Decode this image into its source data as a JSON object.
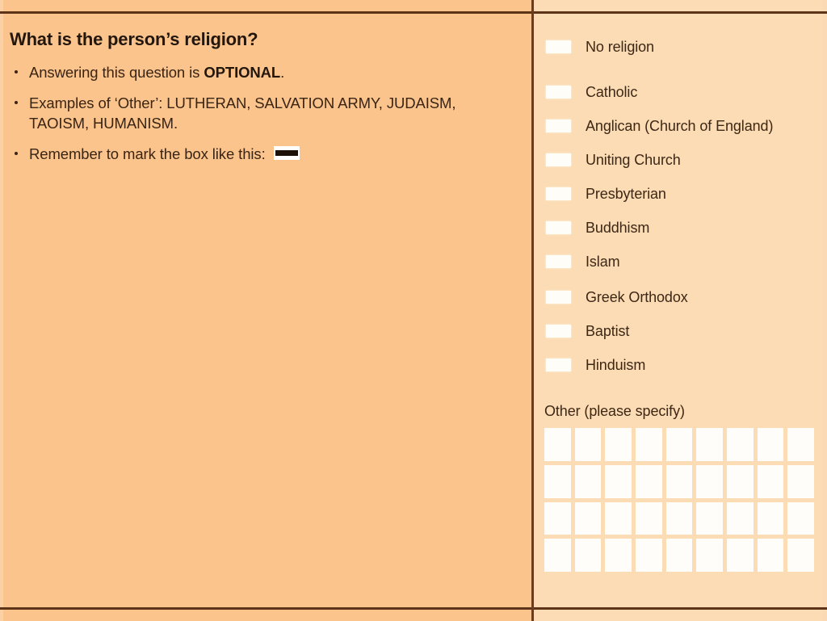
{
  "form": {
    "title": "What is the person's religion?",
    "left_panel": {
      "heading": "What is the person’s religion?",
      "bullets": [
        {
          "prefix": "Answering this question is ",
          "emphasis": "OPTIONAL",
          "suffix": "."
        },
        {
          "prefix": "Examples of ‘Other’: LUTHERAN, SALVATION ARMY, JUDAISM, TAOISM, HUMANISM.",
          "emphasis": "",
          "suffix": ""
        },
        {
          "prefix": "Remember to mark the box like this:",
          "emphasis": "",
          "suffix": ""
        }
      ],
      "mark_example_icon": "filled-mark-box-icon"
    },
    "right_panel": {
      "options": [
        {
          "label": "No religion",
          "checked": false
        },
        {
          "label": "Catholic",
          "checked": false
        },
        {
          "label": "Anglican (Church of England)",
          "checked": false
        },
        {
          "label": "Uniting Church",
          "checked": false
        },
        {
          "label": "Presbyterian",
          "checked": false
        },
        {
          "label": "Buddhism",
          "checked": false
        },
        {
          "label": "Islam",
          "checked": false
        },
        {
          "label": "Greek Orthodox",
          "checked": false
        },
        {
          "label": "Baptist",
          "checked": false
        },
        {
          "label": "Hinduism",
          "checked": false
        }
      ],
      "other_label": "Other (please specify)",
      "write_in_grid": {
        "columns": 9,
        "rows": 4,
        "cells": [
          "",
          "",
          "",
          "",
          "",
          "",
          "",
          "",
          "",
          "",
          "",
          "",
          "",
          "",
          "",
          "",
          "",
          "",
          "",
          "",
          "",
          "",
          "",
          "",
          "",
          "",
          "",
          "",
          "",
          "",
          "",
          "",
          "",
          "",
          "",
          ""
        ]
      }
    },
    "colors": {
      "left_background": "#fac48c",
      "right_background": "#fcdcb4",
      "rule": "#5d3418",
      "divider": "#6b3d1d",
      "text": "#3a2414",
      "heading_text": "#23160c",
      "box_fill": "#fffdf8",
      "mark_bar": "#1b1108"
    }
  }
}
